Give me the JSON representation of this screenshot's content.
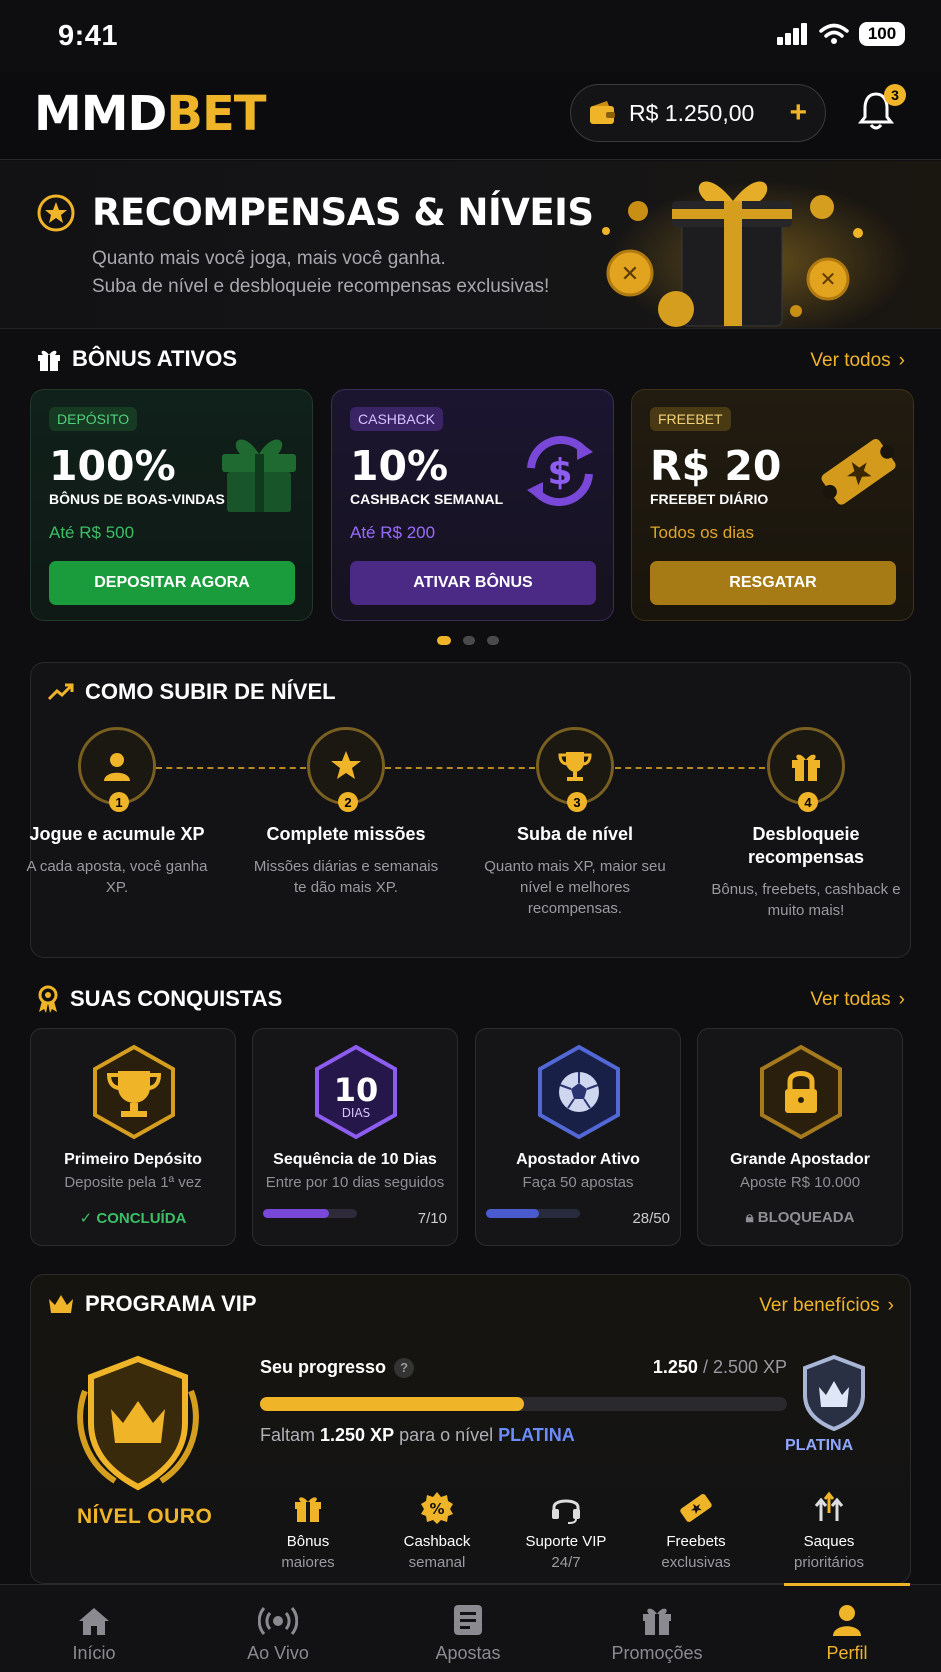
{
  "status": {
    "time": "9:41",
    "battery": "100"
  },
  "header": {
    "logo_part1": "MMD",
    "logo_part2": "BET",
    "balance": "R$ 1.250,00",
    "notifications": "3"
  },
  "hero": {
    "title": "RECOMPENSAS & NÍVEIS",
    "line1": "Quanto mais você joga, mais você ganha.",
    "line2": "Suba de nível e desbloqueie recompensas exclusivas!"
  },
  "bonus": {
    "title": "BÔNUS ATIVOS",
    "link": "Ver todos",
    "cards": [
      {
        "tag": "DEPÓSITO",
        "big": "100%",
        "small": "BÔNUS DE BOAS-VINDAS",
        "limit": "Até R$ 500",
        "button": "DEPOSITAR AGORA"
      },
      {
        "tag": "CASHBACK",
        "big": "10%",
        "small": "CASHBACK SEMANAL",
        "limit": "Até R$ 200",
        "button": "ATIVAR BÔNUS"
      },
      {
        "tag": "FREEBET",
        "big": "R$ 20",
        "small": "FREEBET DIÁRIO",
        "limit": "Todos os dias",
        "button": "RESGATAR"
      }
    ]
  },
  "levelup": {
    "title": "COMO SUBIR DE NÍVEL",
    "steps": [
      {
        "num": "1",
        "title": "Jogue e acumule XP",
        "desc": "A cada aposta, você ganha XP."
      },
      {
        "num": "2",
        "title": "Complete missões",
        "desc": "Missões diárias e semanais te dão mais XP."
      },
      {
        "num": "3",
        "title": "Suba de nível",
        "desc": "Quanto mais XP, maior seu nível e melhores recompensas."
      },
      {
        "num": "4",
        "title": "Desbloqueie recompensas",
        "desc": "Bônus, freebets, cashback e muito mais!"
      }
    ]
  },
  "achievements": {
    "title": "SUAS CONQUISTAS",
    "link": "Ver todas",
    "items": [
      {
        "name": "Primeiro Depósito",
        "desc": "Deposite pela 1ª vez",
        "status": "CONCLUÍDA"
      },
      {
        "name": "Sequência de 10 Dias",
        "desc": "Entre por 10 dias seguidos",
        "count": "7/10",
        "progress": 0.7,
        "badge_num": "10",
        "badge_sub": "DIAS"
      },
      {
        "name": "Apostador Ativo",
        "desc": "Faça 50 apostas",
        "count": "28/50",
        "progress": 0.56
      },
      {
        "name": "Grande Apostador",
        "desc": "Aposte R$ 10.000",
        "status": "BLOQUEADA"
      }
    ]
  },
  "vip": {
    "title": "PROGRAMA VIP",
    "link": "Ver benefícios",
    "level": "NÍVEL OURO",
    "progress_label": "Seu progresso",
    "help": "?",
    "xp_current": "1.250",
    "xp_total": "/ 2.500 XP",
    "progress": 0.5,
    "remaining_pre": "Faltam ",
    "remaining_xp": "1.250 XP",
    "remaining_mid": " para o nível ",
    "next_level": "PLATINA",
    "next_badge": "PLATINA",
    "benefits": [
      {
        "l1": "Bônus",
        "l2": "maiores"
      },
      {
        "l1": "Cashback",
        "l2": "semanal"
      },
      {
        "l1": "Suporte VIP",
        "l2": "24/7"
      },
      {
        "l1": "Freebets",
        "l2": "exclusivas"
      },
      {
        "l1": "Saques",
        "l2": "prioritários"
      }
    ]
  },
  "nav": [
    {
      "label": "Início"
    },
    {
      "label": "Ao Vivo"
    },
    {
      "label": "Apostas"
    },
    {
      "label": "Promoções"
    },
    {
      "label": "Perfil"
    }
  ],
  "colors": {
    "accent": "#f0b429",
    "green": "#1a9b3c",
    "purple": "#5a2f9c",
    "platinum": "#6b8cff"
  }
}
